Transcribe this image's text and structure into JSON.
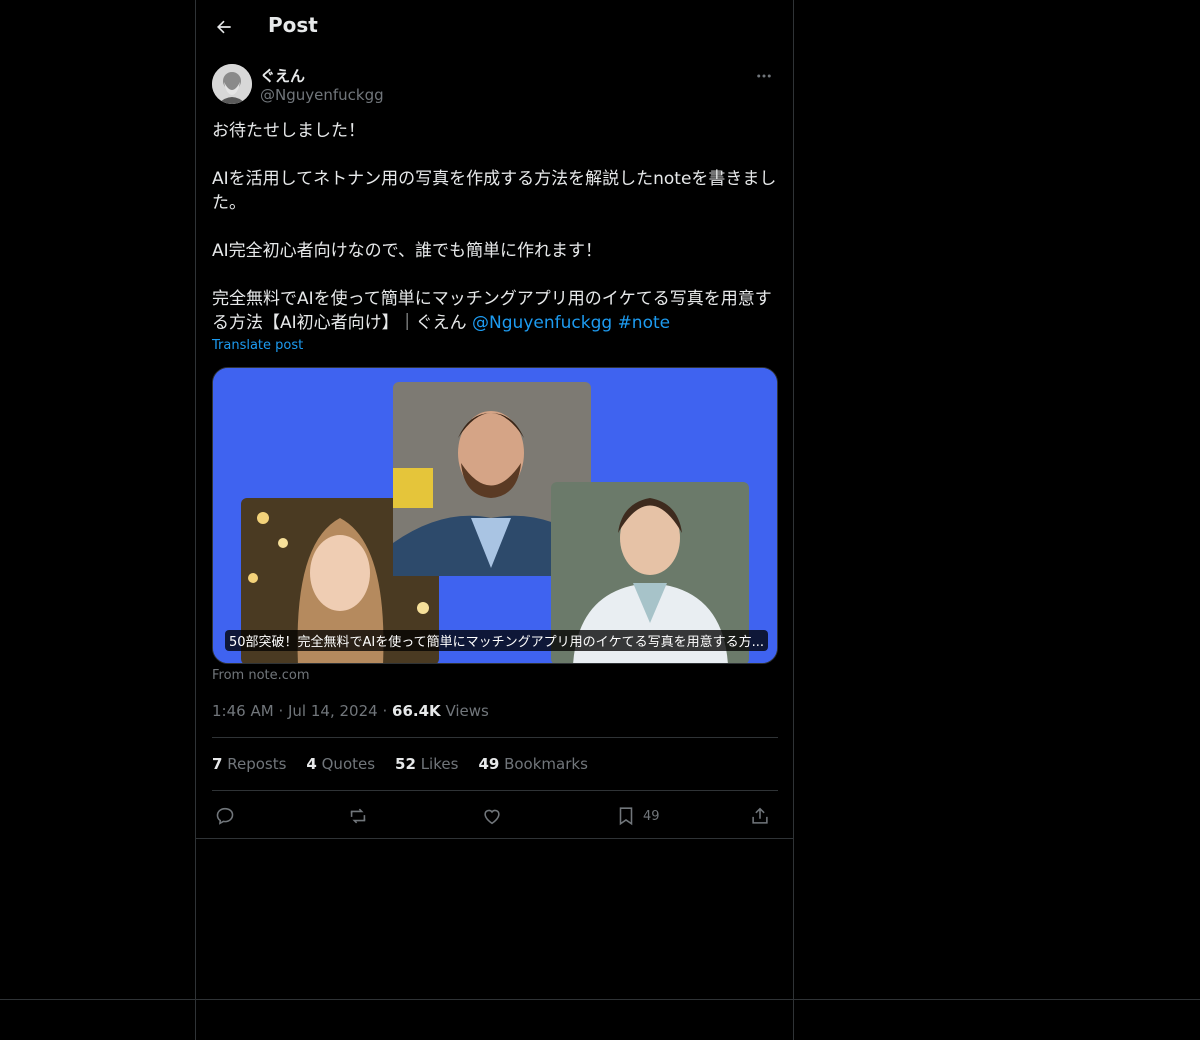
{
  "header": {
    "title": "Post"
  },
  "author": {
    "name": "ぐえん",
    "handle": "@Nguyenfuckgg"
  },
  "post": {
    "body": "お待たせしました！\n\nAIを活用してネトナン用の写真を作成する方法を解説したnoteを書きました。\n\nAI完全初心者向けなので、誰でも簡単に作れます！\n\n完全無料でAIを使って簡単にマッチングアプリ用のイケてる写真を用意する方法【AI初心者向け】｜ぐえん ",
    "mention": "@Nguyenfuckgg",
    "hashtag": "#note",
    "translate_label": "Translate post"
  },
  "card": {
    "caption": "50部突破！完全無料でAIを使って簡単にマッチングアプリ用のイケてる写真を用意する方...",
    "source": "From note.com"
  },
  "meta": {
    "time": "1:46 AM",
    "date": "Jul 14, 2024",
    "views_count": "66.4K",
    "views_label": "Views",
    "sep": "·"
  },
  "stats": {
    "reposts": {
      "count": "7",
      "label": "Reposts"
    },
    "quotes": {
      "count": "4",
      "label": "Quotes"
    },
    "likes": {
      "count": "52",
      "label": "Likes"
    },
    "bookmarks": {
      "count": "49",
      "label": "Bookmarks"
    }
  },
  "actions": {
    "reply_icon": "reply-icon",
    "repost_icon": "repost-icon",
    "like_icon": "heart-icon",
    "bookmark_icon": "bookmark-icon",
    "bookmark_count": "49",
    "share_icon": "share-icon"
  },
  "colors": {
    "background": "#000000",
    "accent": "#1d9bf0",
    "card_bg": "#3f63f0",
    "muted": "#71767b"
  }
}
